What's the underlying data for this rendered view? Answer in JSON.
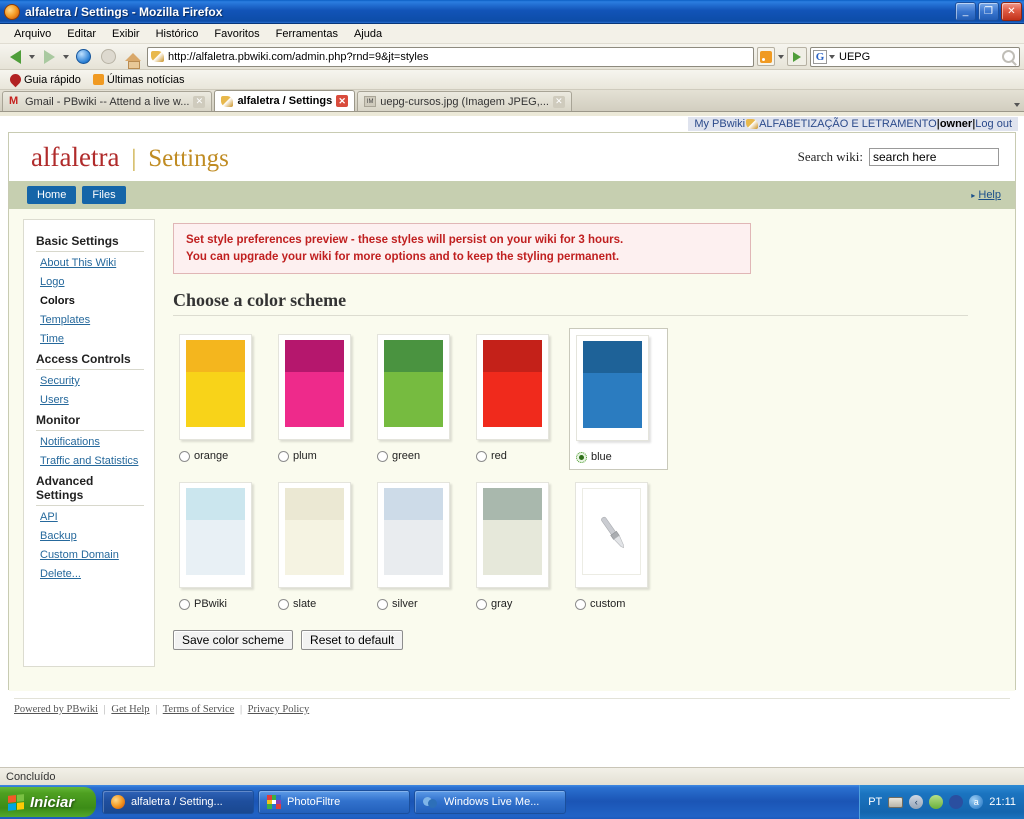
{
  "window": {
    "title": "alfaletra / Settings - Mozilla Firefox",
    "minimize_label": "_",
    "maximize_label": "❐",
    "close_label": "✕"
  },
  "menubar": [
    "Arquivo",
    "Editar",
    "Exibir",
    "Histórico",
    "Favoritos",
    "Ferramentas",
    "Ajuda"
  ],
  "toolbar": {
    "url": "http://alfaletra.pbwiki.com/admin.php?rnd=9&jt=styles",
    "search_engine": "G",
    "search_value": "UEPG"
  },
  "bookmarks": [
    {
      "label": "Guia rápido",
      "icon": "bookmark-icon"
    },
    {
      "label": "Últimas notícias",
      "icon": "rss-icon"
    }
  ],
  "tabs": [
    {
      "label": "Gmail - PBwiki -- Attend a live w...",
      "icon": "gmail-icon",
      "active": false
    },
    {
      "label": "alfaletra / Settings",
      "icon": "pbwiki-icon",
      "active": true
    },
    {
      "label": "uepg-cursos.jpg (Imagem JPEG,...",
      "icon": "image-icon",
      "active": false
    }
  ],
  "pbwiki_bar": {
    "my_pbwiki": "My PBwiki",
    "wiki_name": "ALFABETIZAÇÃO E LETRAMENTO",
    "separator": "|",
    "role": "owner",
    "logout": "Log out"
  },
  "header": {
    "wiki_title": "alfaletra",
    "divider": "|",
    "page_title": "Settings",
    "search_label": "Search wiki:",
    "search_placeholder": "search here",
    "search_value": "search here"
  },
  "navstrip": {
    "tabs": [
      "Home",
      "Files"
    ],
    "help": "Help",
    "help_arrow": "▸"
  },
  "sidebar": {
    "groups": [
      {
        "heading": "Basic Settings",
        "items": [
          {
            "label": "About This Wiki",
            "current": false
          },
          {
            "label": "Logo",
            "current": false
          },
          {
            "label": "Colors",
            "current": true
          },
          {
            "label": "Templates",
            "current": false
          },
          {
            "label": "Time",
            "current": false
          }
        ]
      },
      {
        "heading": "Access Controls",
        "items": [
          {
            "label": "Security",
            "current": false
          },
          {
            "label": "Users",
            "current": false
          }
        ]
      },
      {
        "heading": "Monitor",
        "items": [
          {
            "label": "Notifications",
            "current": false
          },
          {
            "label": "Traffic and Statistics",
            "current": false
          }
        ]
      },
      {
        "heading": "Advanced Settings",
        "items": [
          {
            "label": "API",
            "current": false
          },
          {
            "label": "Backup",
            "current": false
          },
          {
            "label": "Custom Domain",
            "current": false
          },
          {
            "label": "Delete...",
            "current": false
          }
        ]
      }
    ]
  },
  "main": {
    "notice_line1": "Set style preferences preview - these styles will persist on your wiki for 3 hours.",
    "notice_line2": "You can upgrade your wiki for more options and to keep the styling permanent.",
    "notice_color": "#c02020",
    "section_title": "Choose a color scheme",
    "schemes_row1": [
      {
        "label": "orange",
        "selected": false,
        "base": "#f8d319",
        "band": "#f4b61e"
      },
      {
        "label": "plum",
        "selected": false,
        "base": "#ee2a8b",
        "band": "#b5176d"
      },
      {
        "label": "green",
        "selected": false,
        "base": "#76bb40",
        "band": "#4a9340"
      },
      {
        "label": "red",
        "selected": false,
        "base": "#f02a1c",
        "band": "#c42119"
      },
      {
        "label": "blue",
        "selected": true,
        "base": "#2b7cc0",
        "band": "#1e6298"
      }
    ],
    "schemes_row2": [
      {
        "label": "PBwiki",
        "selected": false,
        "base": "#e8f0f5",
        "band": "#cbe6ee"
      },
      {
        "label": "slate",
        "selected": false,
        "base": "#f5f3e2",
        "band": "#ebe8d3"
      },
      {
        "label": "silver",
        "selected": false,
        "base": "#e9ecef",
        "band": "#cddbe8"
      },
      {
        "label": "gray",
        "selected": false,
        "base": "#e6e8da",
        "band": "#a9b8ad"
      },
      {
        "label": "custom",
        "selected": false,
        "base": "#ffffff",
        "band": "#ffffff",
        "icon": "paintbrush-icon"
      }
    ],
    "save_button": "Save color scheme",
    "reset_button": "Reset to default"
  },
  "footer": {
    "links": [
      "Powered by PBwiki",
      "Get Help",
      "Terms of Service",
      "Privacy Policy"
    ],
    "separator": "|"
  },
  "statusbar": {
    "text": "Concluído"
  },
  "taskbar": {
    "start_label": "Iniciar",
    "items": [
      {
        "label": "alfaletra / Setting...",
        "icon": "firefox-icon",
        "active": true
      },
      {
        "label": "PhotoFiltre",
        "icon": "photofiltre-icon",
        "active": false
      },
      {
        "label": "Windows Live Me...",
        "icon": "wlm-icon",
        "active": false
      }
    ],
    "tray": {
      "language": "PT",
      "clock": "21:11"
    }
  }
}
